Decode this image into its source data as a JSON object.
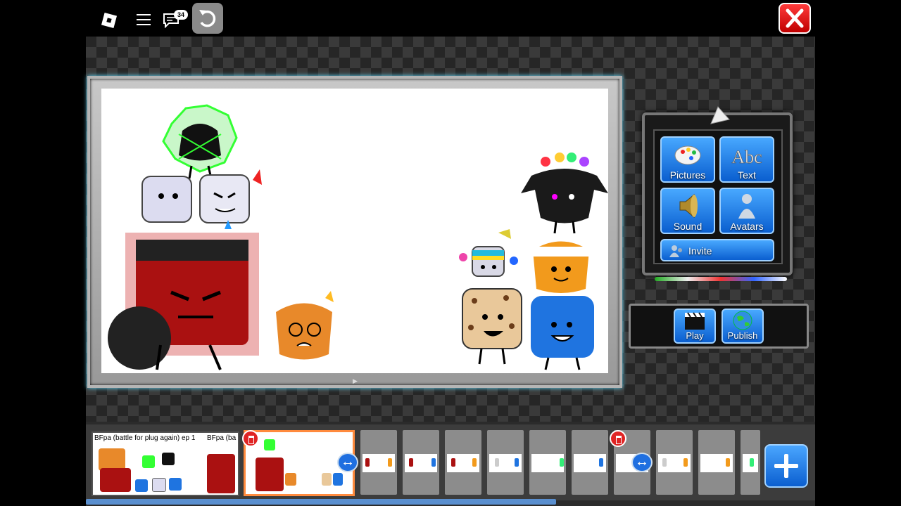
{
  "topbar": {
    "chat_count": "34"
  },
  "tools": {
    "pictures_label": "Pictures",
    "text_label": "Text",
    "sound_label": "Sound",
    "avatars_label": "Avatars",
    "invite_label": "Invite"
  },
  "player": {
    "play_label": "Play",
    "publish_label": "Publish"
  },
  "timeline": {
    "first_frame_title": "BFpa (battle for plug again) ep 1",
    "second_title_fragment": "BFpa (ba"
  },
  "colors": {
    "accent_blue": "#0a5ecf",
    "close_red": "#e02424",
    "selected_border": "#ff8a3d"
  }
}
